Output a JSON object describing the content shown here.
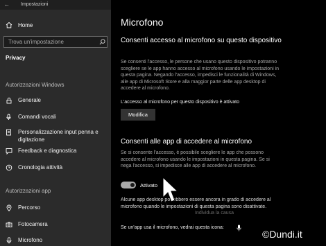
{
  "window": {
    "title": "Impostazioni"
  },
  "sidebar": {
    "home_label": "Home",
    "search_placeholder": "Trova un'impostazione",
    "privacy_label": "Privacy",
    "section_windows": "Autorizzazioni Windows",
    "windows_items": [
      {
        "label": "Generale",
        "icon": "lock-icon"
      },
      {
        "label": "Comandi vocali",
        "icon": "microphone-speech-icon"
      },
      {
        "label": "Personalizzazione input penna e digitazione",
        "icon": "notepad-pen-icon"
      },
      {
        "label": "Feedback e diagnostica",
        "icon": "feedback-icon"
      },
      {
        "label": "Cronologia attività",
        "icon": "activity-history-icon"
      }
    ],
    "section_app": "Autorizzazioni app",
    "app_items": [
      {
        "label": "Percorso",
        "icon": "location-icon"
      },
      {
        "label": "Fotocamera",
        "icon": "camera-icon"
      },
      {
        "label": "Microfono",
        "icon": "microphone-icon"
      }
    ]
  },
  "main": {
    "title": "Microfono",
    "device_heading": "Consenti accesso al microfono su questo dispositivo",
    "device_desc": "Se consenti l'accesso, le persone che usano questo dispositivo potranno scegliere se le app hanno accesso al microfono usando le impostazioni in questa pagina. Negando l'accesso, impedisci le funzionalità di Windows, alle app di Microsoft Store e alla maggior parte delle app desktop di accedere al microfono.",
    "device_status": "L'accesso al microfono per questo dispositivo è attivato",
    "modify_button": "Modifica",
    "apps_heading": "Consenti alle app di accedere al microfono",
    "apps_desc": "Se si consente l'accesso, è possibile scegliere le app che possono accedere al microfono usando le impostazioni in questa pagina. Se si nega l'accesso, si impedisce alle app di accedere al microfono.",
    "toggle_state": "Attivato",
    "toggle_on": true,
    "note_text": "Alcune app desktop potrebbero essere ancora in grado di accedere al microfono quando le impostazioni di questa pagina sono disattivate.",
    "note_link": "Individua la causa",
    "bottom_text": "Se un'app usa il microfono, vedrai questa icona:"
  },
  "watermark": "©Dundi.it"
}
